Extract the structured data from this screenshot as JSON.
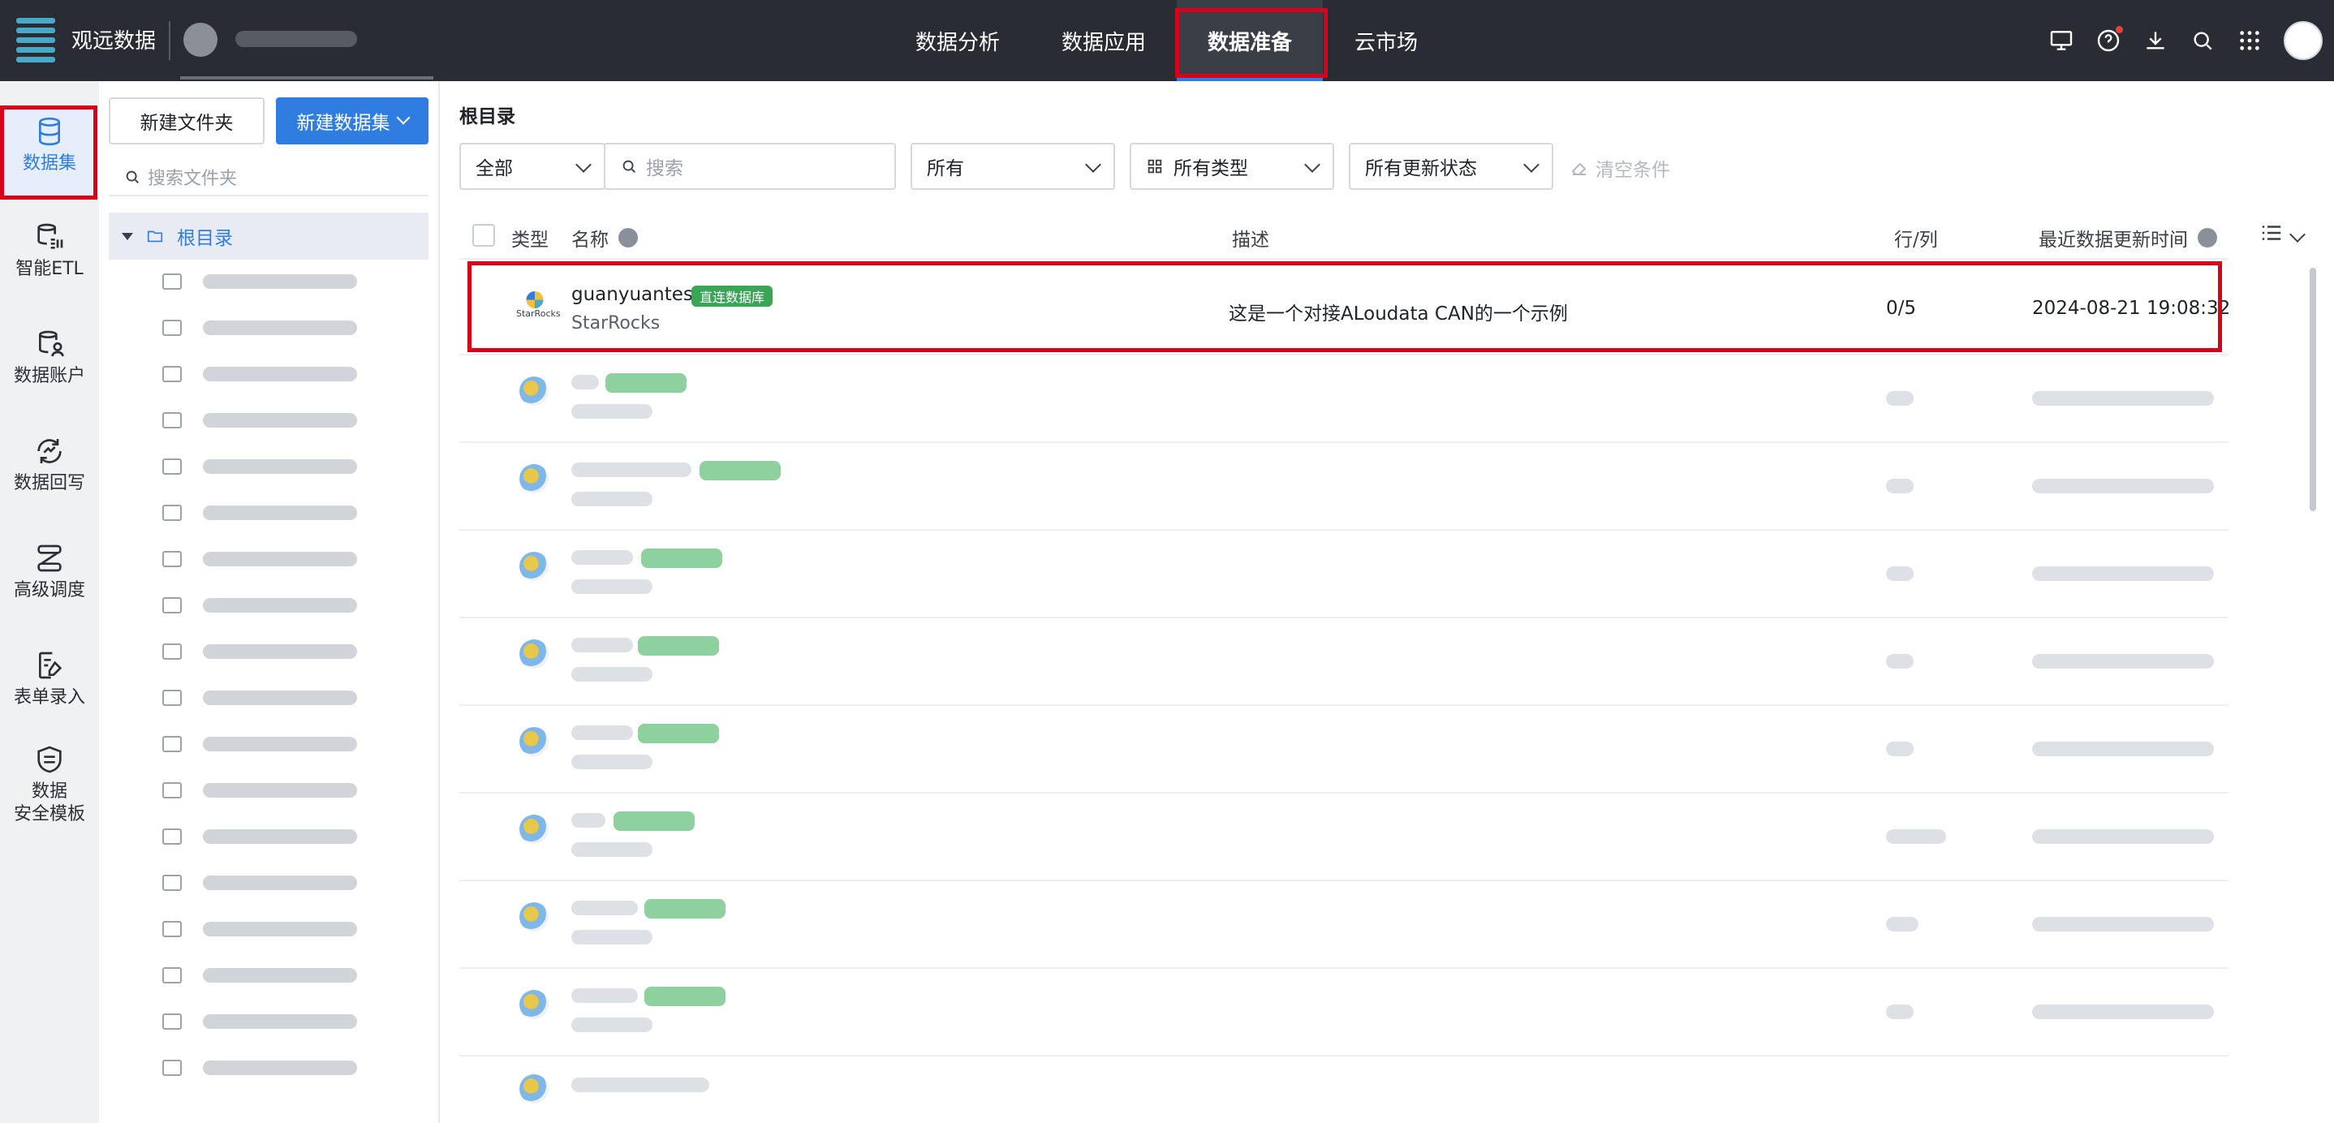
{
  "topbar": {
    "brand": "观远数据",
    "nav": [
      "数据分析",
      "数据应用",
      "数据准备",
      "云市场"
    ],
    "active_nav": "数据准备"
  },
  "leftnav": {
    "items": [
      {
        "label": "数据集",
        "icon": "database-icon"
      },
      {
        "label": "智能ETL",
        "icon": "etl-icon"
      },
      {
        "label": "数据账户",
        "icon": "data-account-icon"
      },
      {
        "label": "数据回写",
        "icon": "writeback-icon"
      },
      {
        "label": "高级调度",
        "icon": "schedule-icon"
      },
      {
        "label": "表单录入",
        "icon": "form-entry-icon"
      },
      {
        "label": "数据安全模板",
        "line1": "数据",
        "line2": "安全模板",
        "icon": "security-template-icon"
      }
    ]
  },
  "folders": {
    "new_folder": "新建文件夹",
    "new_dataset": "新建数据集",
    "search_placeholder": "搜索文件夹",
    "root": "根目录"
  },
  "main": {
    "breadcrumb": "根目录",
    "filters": {
      "scope": "全部",
      "search_placeholder": "搜索",
      "owner": "所有",
      "type": "所有类型",
      "update_status": "所有更新状态",
      "clear": "清空条件"
    },
    "columns": {
      "type": "类型",
      "name": "名称",
      "desc": "描述",
      "rows_cols": "行/列",
      "updated": "最近数据更新时间"
    },
    "first_row": {
      "name": "guanyuantest",
      "tag": "直连数据库",
      "source": "StarRocks",
      "logo_text": "StarRocks",
      "desc": "这是一个对接ALoudata CAN的一个示例",
      "rows_cols": "0/5",
      "updated": "2024-08-21 19:08:32"
    }
  },
  "colors": {
    "accent": "#2f7de1",
    "highlight": "#d9001b",
    "tag": "#3aa655",
    "topbar": "#292c33"
  }
}
